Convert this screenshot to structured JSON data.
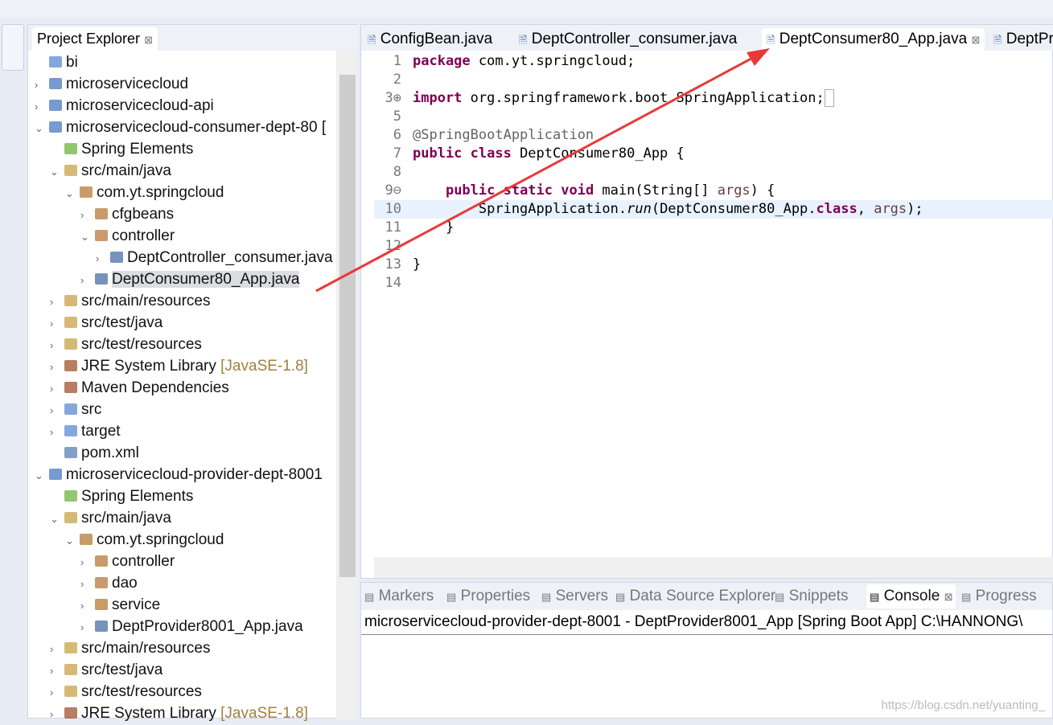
{
  "project_explorer": {
    "title": "Project Explorer",
    "close": "⊠",
    "tree": [
      {
        "label": "bi",
        "level": 0,
        "arrow": "",
        "icon": "folder"
      },
      {
        "label": "microservicecloud",
        "level": 0,
        "arrow": ">",
        "icon": "maven-project"
      },
      {
        "label": "microservicecloud-api",
        "level": 0,
        "arrow": ">",
        "icon": "maven-project"
      },
      {
        "label": "microservicecloud-consumer-dept-80 [",
        "level": 0,
        "arrow": "v",
        "icon": "maven-project"
      },
      {
        "label": "Spring Elements",
        "level": 1,
        "arrow": "",
        "icon": "spring"
      },
      {
        "label": "src/main/java",
        "level": 1,
        "arrow": "v",
        "icon": "source-folder"
      },
      {
        "label": "com.yt.springcloud",
        "level": 2,
        "arrow": "v",
        "icon": "package"
      },
      {
        "label": "cfgbeans",
        "level": 3,
        "arrow": ">",
        "icon": "package"
      },
      {
        "label": "controller",
        "level": 3,
        "arrow": "v",
        "icon": "package"
      },
      {
        "label": "DeptController_consumer.java",
        "level": 4,
        "arrow": ">",
        "icon": "java-file"
      },
      {
        "label": "DeptConsumer80_App.java",
        "level": 3,
        "arrow": ">",
        "icon": "java-file",
        "selected": true
      },
      {
        "label": "src/main/resources",
        "level": 1,
        "arrow": ">",
        "icon": "source-folder"
      },
      {
        "label": "src/test/java",
        "level": 1,
        "arrow": ">",
        "icon": "source-folder"
      },
      {
        "label": "src/test/resources",
        "level": 1,
        "arrow": ">",
        "icon": "source-folder"
      },
      {
        "label": "JRE System Library",
        "decoration": "[JavaSE-1.8]",
        "level": 1,
        "arrow": ">",
        "icon": "library"
      },
      {
        "label": "Maven Dependencies",
        "level": 1,
        "arrow": ">",
        "icon": "library"
      },
      {
        "label": "src",
        "level": 1,
        "arrow": ">",
        "icon": "folder"
      },
      {
        "label": "target",
        "level": 1,
        "arrow": ">",
        "icon": "folder"
      },
      {
        "label": "pom.xml",
        "level": 1,
        "arrow": "",
        "icon": "xml-file"
      },
      {
        "label": "microservicecloud-provider-dept-8001",
        "level": 0,
        "arrow": "v",
        "icon": "maven-project"
      },
      {
        "label": "Spring Elements",
        "level": 1,
        "arrow": "",
        "icon": "spring"
      },
      {
        "label": "src/main/java",
        "level": 1,
        "arrow": "v",
        "icon": "source-folder"
      },
      {
        "label": "com.yt.springcloud",
        "level": 2,
        "arrow": "v",
        "icon": "package"
      },
      {
        "label": "controller",
        "level": 3,
        "arrow": ">",
        "icon": "package"
      },
      {
        "label": "dao",
        "level": 3,
        "arrow": ">",
        "icon": "package"
      },
      {
        "label": "service",
        "level": 3,
        "arrow": ">",
        "icon": "package"
      },
      {
        "label": "DeptProvider8001_App.java",
        "level": 3,
        "arrow": ">",
        "icon": "java-file"
      },
      {
        "label": "src/main/resources",
        "level": 1,
        "arrow": ">",
        "icon": "source-folder"
      },
      {
        "label": "src/test/java",
        "level": 1,
        "arrow": ">",
        "icon": "source-folder"
      },
      {
        "label": "src/test/resources",
        "level": 1,
        "arrow": ">",
        "icon": "source-folder"
      },
      {
        "label": "JRE System Library",
        "decoration": "[JavaSE-1.8]",
        "level": 1,
        "arrow": ">",
        "icon": "library"
      }
    ]
  },
  "editor": {
    "tabs": [
      {
        "label": "ConfigBean.java"
      },
      {
        "label": "DeptController_consumer.java"
      },
      {
        "label": "DeptConsumer80_App.java",
        "active": true,
        "close": "⊠"
      },
      {
        "label": "DeptPr"
      }
    ],
    "lines": [
      {
        "n": "1",
        "html": "<span class='kw'>package</span> com.yt.springcloud;"
      },
      {
        "n": "2",
        "html": ""
      },
      {
        "n": "3⊕",
        "html": "<span class='kw'>import</span> org.springframework.boot.SpringApplication;<span style='border:1px solid #aaa'>&nbsp;</span>"
      },
      {
        "n": "5",
        "html": ""
      },
      {
        "n": "6",
        "html": "<span class='an'>@SpringBootApplication</span>"
      },
      {
        "n": "7",
        "html": "<span class='kw'>public class</span> DeptConsumer80_App {"
      },
      {
        "n": "8",
        "html": ""
      },
      {
        "n": "9⊖",
        "html": "    <span class='kw'>public static void</span> main(String[] <span class='pa'>args</span>) {"
      },
      {
        "n": "10",
        "html": "        SpringApplication.<span class='it'>run</span>(DeptConsumer80_App.<span class='kw'>class</span>, <span class='pa'>args</span>);",
        "current": true
      },
      {
        "n": "11",
        "html": "    }"
      },
      {
        "n": "12",
        "html": ""
      },
      {
        "n": "13",
        "html": "}"
      },
      {
        "n": "14",
        "html": ""
      }
    ]
  },
  "bottom_panel": {
    "tabs": [
      {
        "label": "Markers"
      },
      {
        "label": "Properties"
      },
      {
        "label": "Servers"
      },
      {
        "label": "Data Source Explorer"
      },
      {
        "label": "Snippets"
      },
      {
        "label": "Console",
        "active": true
      },
      {
        "label": "Progress"
      }
    ],
    "console_line": "microservicecloud-provider-dept-8001 - DeptProvider8001_App [Spring Boot App] C:\\HANNONG\\"
  },
  "watermark": "https://blog.csdn.net/yuanting_",
  "colors": {
    "keyword": "#7f0055",
    "annotation_arrow": "#e83a3a"
  }
}
